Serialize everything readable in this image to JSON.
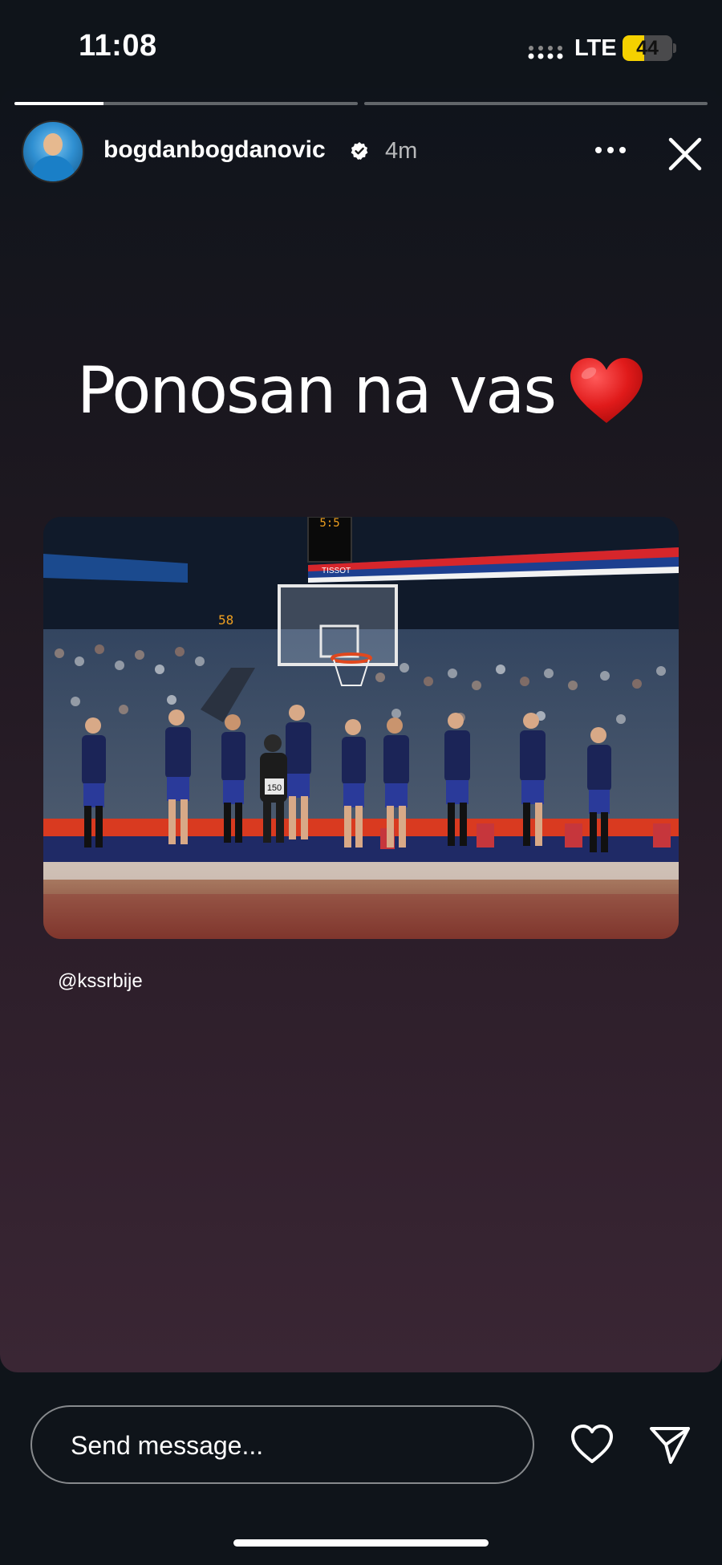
{
  "status_bar": {
    "time": "11:08",
    "network": "LTE",
    "battery": "44",
    "battery_level": 0.44,
    "colors": {
      "battery_fill": "#f5d100"
    }
  },
  "story": {
    "progress": [
      {
        "segment": 1,
        "fill": 0.26
      },
      {
        "segment": 2,
        "fill": 0
      }
    ],
    "username": "bogdanbogdanovic",
    "verified": true,
    "time_ago": "4m",
    "caption": "Ponosan na vas",
    "caption_emoji": "red-heart-icon",
    "mention": "@kssrbije",
    "photo": {
      "scoreboard_a": "5:5",
      "scoreboard_b": "58",
      "sponsor": "TISSOT",
      "photographer_bib": "150"
    }
  },
  "footer": {
    "message_placeholder": "Send message...",
    "icons": [
      "heart-icon",
      "send-icon"
    ]
  },
  "colors": {
    "background": "#0f141a",
    "text": "#ffffff",
    "jersey": "#1b2457"
  }
}
